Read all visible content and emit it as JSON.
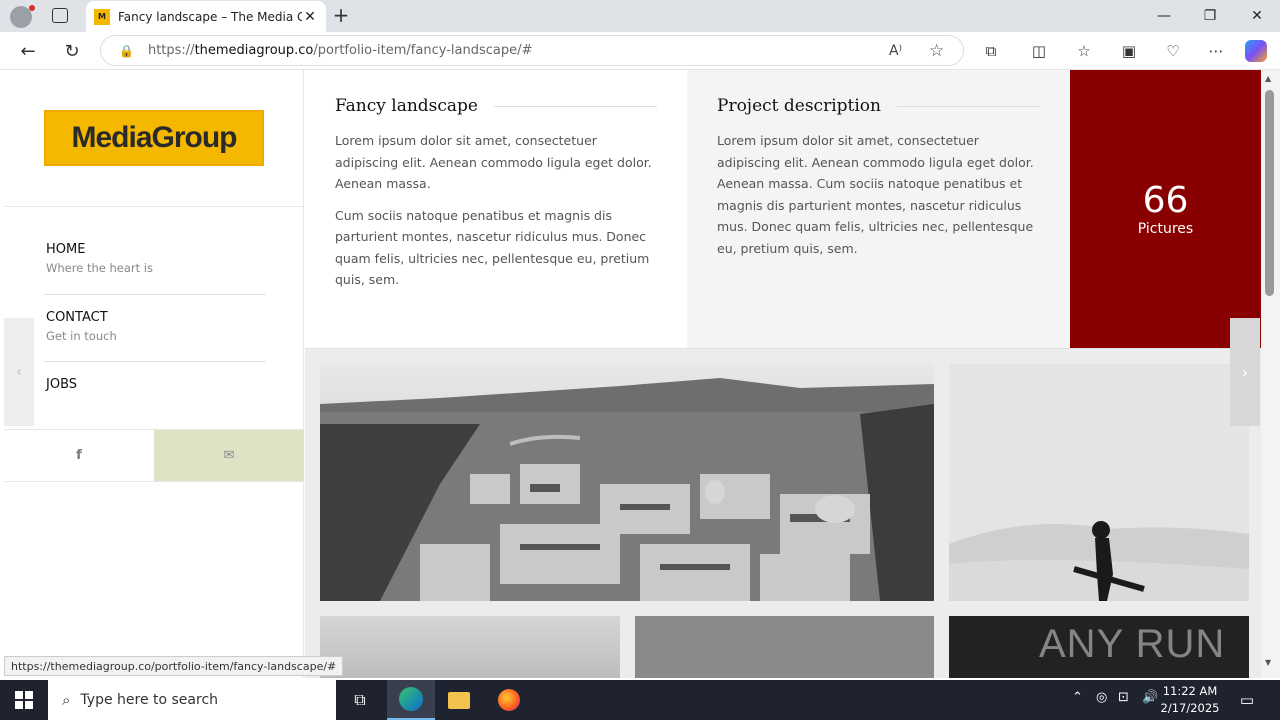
{
  "browser": {
    "tab_title": "Fancy landscape – The Media Gro",
    "tab_favicon": "M",
    "url_scheme": "https://",
    "url_host": "themediagroup.co",
    "url_path": "/portfolio-item/fancy-landscape/#"
  },
  "sidebar": {
    "logo_text": "MediaGroup",
    "nav": [
      {
        "label": "HOME",
        "sub": "Where the heart is"
      },
      {
        "label": "CONTACT",
        "sub": "Get in touch"
      },
      {
        "label": "JOBS",
        "sub": ""
      }
    ],
    "facebook_icon": "f",
    "mail_icon": "✉"
  },
  "content": {
    "title": "Fancy landscape",
    "para1": "Lorem ipsum dolor sit amet, consectetuer adipiscing elit. Aenean commodo ligula eget dolor. Aenean massa.",
    "para2": "Cum sociis natoque penatibus et magnis dis parturient montes, nascetur ridiculus mus. Donec quam felis, ultricies nec, pellentesque eu, pretium quis, sem.",
    "desc_title": "Project description",
    "desc_para": "Lorem ipsum dolor sit amet, consectetuer adipiscing elit. Aenean commodo ligula eget dolor. Aenean massa. Cum sociis natoque penatibus et magnis dis parturient montes, nascetur ridiculus mus. Donec quam felis, ultricies nec, pellentesque eu, pretium quis, sem.",
    "count": "66",
    "count_label": "Pictures"
  },
  "watermark": "ANY RUN",
  "status_url": "https://themediagroup.co/portfolio-item/fancy-landscape/#",
  "taskbar": {
    "search_placeholder": "Type here to search",
    "time": "11:22 AM",
    "date": "2/17/2025"
  },
  "colors": {
    "accent": "#880000",
    "logo": "#f5b800"
  }
}
